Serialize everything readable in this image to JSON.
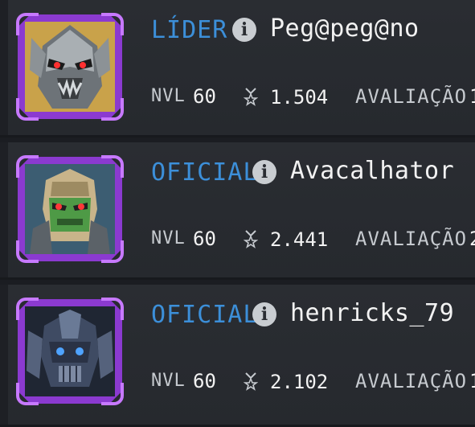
{
  "colors": {
    "role": "#3c8fd9",
    "frame": "#8b3ad0",
    "frame_accent": "#c779ff",
    "row_bg": "#2a2d32",
    "text": "#f2f2f2",
    "label": "#c6cacf"
  },
  "members": [
    {
      "role": "LÍDER",
      "name": "Peg@peg@no",
      "level_label": "NVL",
      "level": "60",
      "power": "1.504",
      "rating_label": "AVALIAÇÃO",
      "rating_partial": "1",
      "avatar_icon": "robot-portrait-silver"
    },
    {
      "role": "OFICIAL",
      "name": "Avacalhator",
      "level_label": "NVL",
      "level": "60",
      "power": "2.441",
      "rating_label": "AVALIAÇÃO",
      "rating_partial": "2",
      "avatar_icon": "robot-portrait-green"
    },
    {
      "role": "OFICIAL",
      "name": "henricks_79",
      "level_label": "NVL",
      "level": "60",
      "power": "2.102",
      "rating_label": "AVALIAÇÃO",
      "rating_partial": "1",
      "avatar_icon": "robot-portrait-blue"
    }
  ]
}
